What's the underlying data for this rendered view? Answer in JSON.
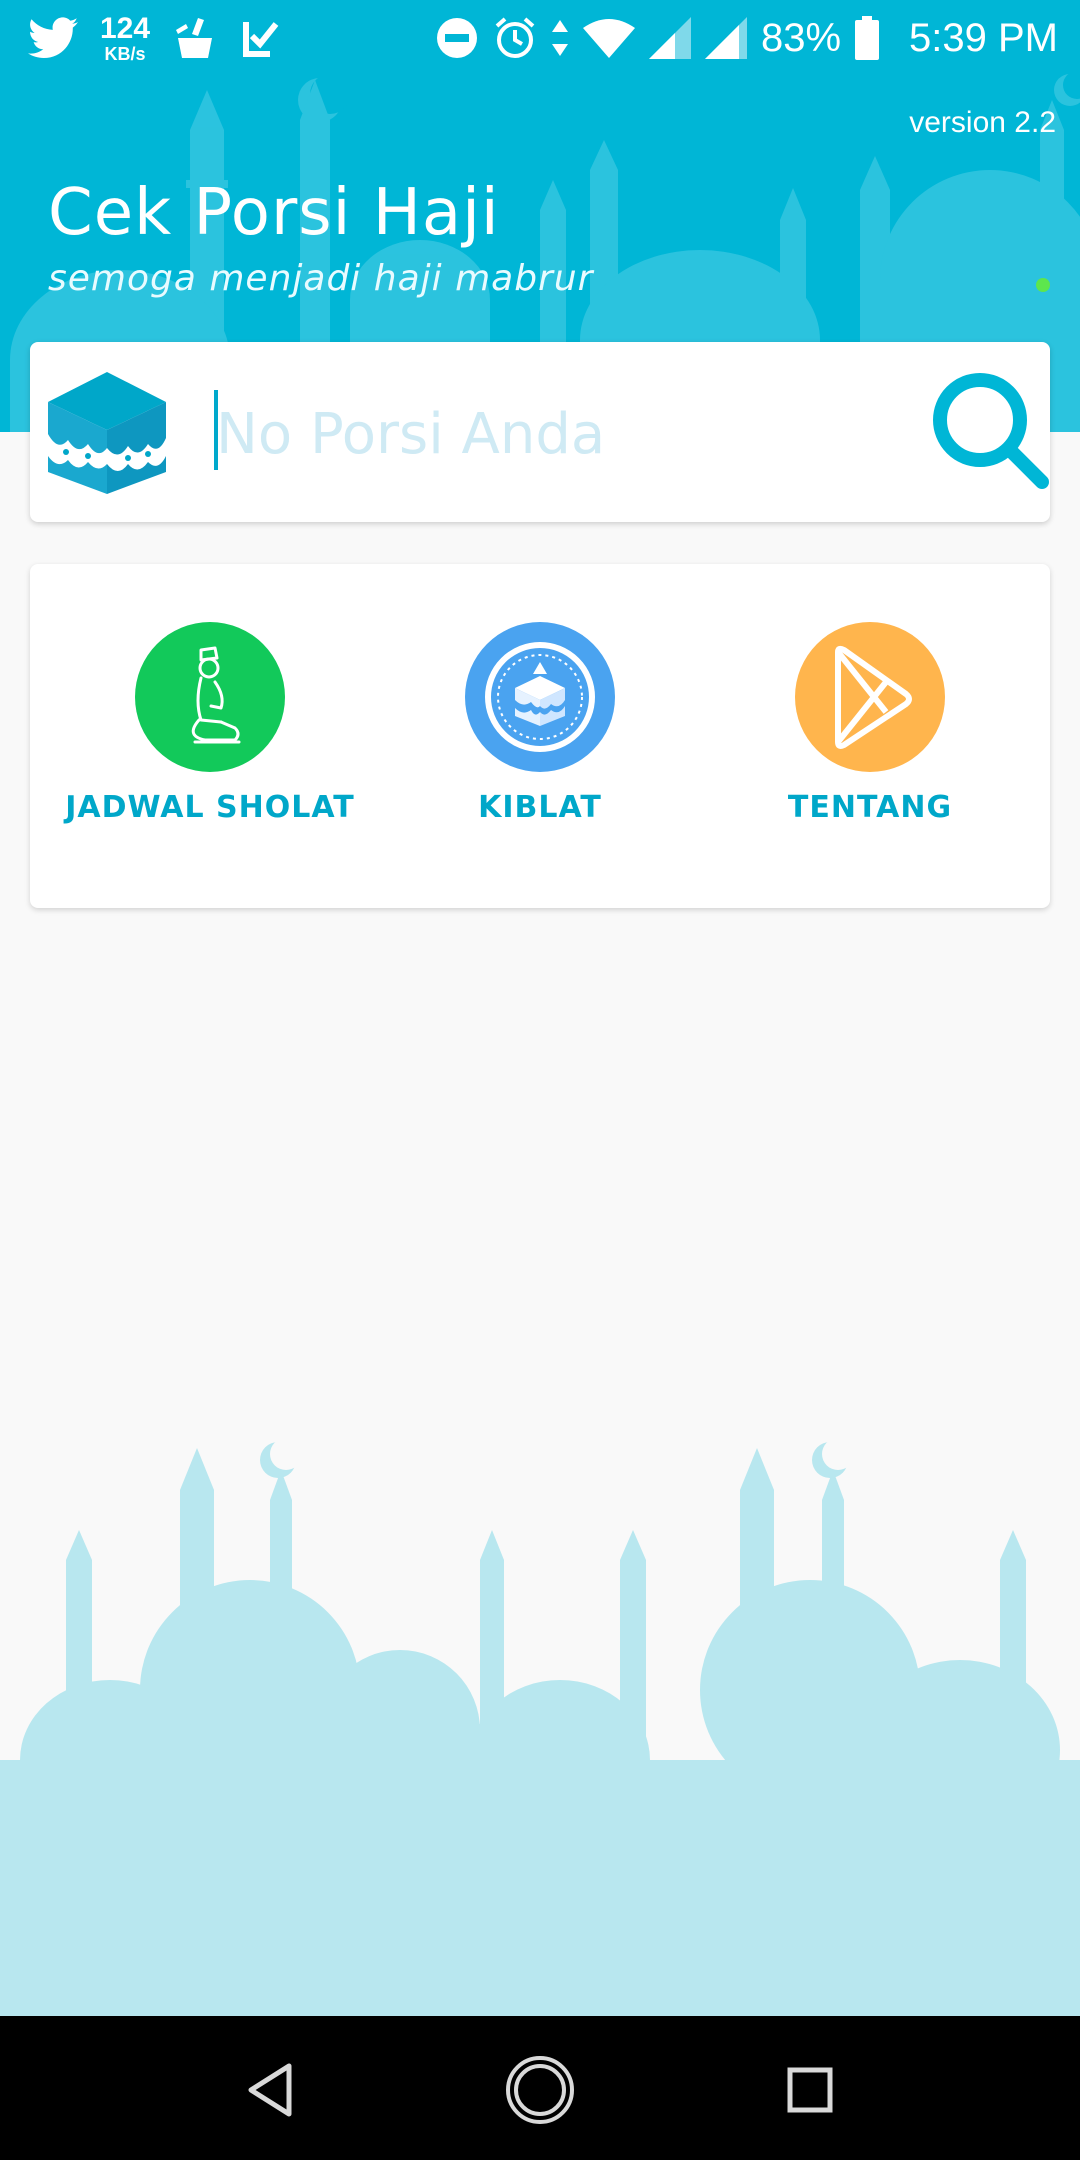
{
  "status_bar": {
    "net_speed_value": "124",
    "net_speed_unit": "KB/s",
    "battery_percent": "83%",
    "time": "5:39 PM",
    "left_icons": [
      "twitter-icon",
      "net-speed-indicator",
      "cleaner-icon",
      "check-icon"
    ],
    "right_icons": [
      "do-not-disturb-icon",
      "alarm-icon",
      "data-arrows-icon",
      "wifi-icon",
      "signal-icon",
      "signal-icon",
      "battery-icon"
    ]
  },
  "header": {
    "version": "version 2.2",
    "title": "Cek Porsi Haji",
    "subtitle": "semoga menjadi haji mabrur",
    "background_color": "#00b6d6"
  },
  "search": {
    "placeholder": "No Porsi Anda",
    "value": "",
    "leading_icon": "kaaba-icon",
    "button_icon": "search-icon"
  },
  "menu": {
    "items": [
      {
        "label": "JADWAL SHOLAT",
        "icon": "praying-person-icon",
        "color": "#12c95a"
      },
      {
        "label": "KIBLAT",
        "icon": "kaaba-compass-icon",
        "color": "#4aa3f0"
      },
      {
        "label": "TENTANG",
        "icon": "play-store-icon",
        "color": "#ffb54d"
      }
    ]
  },
  "nav_bar": {
    "buttons": [
      "back-icon",
      "home-icon",
      "recents-icon"
    ]
  },
  "colors": {
    "accent": "#00a7c9",
    "skyline_light": "#b8e7ef"
  }
}
